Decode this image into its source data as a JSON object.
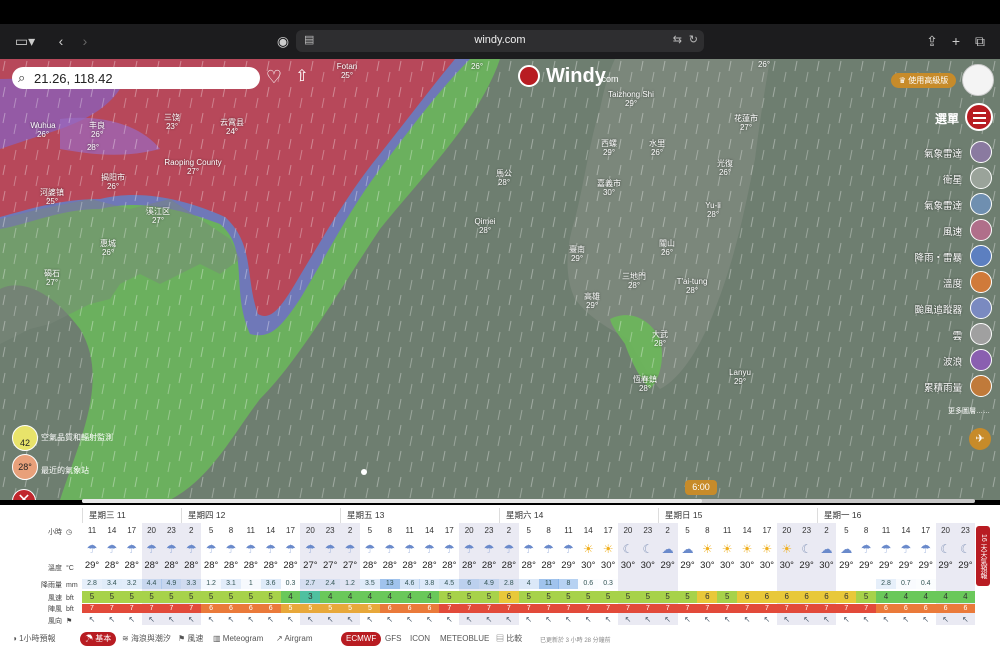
{
  "browser": {
    "url": "windy.com"
  },
  "map": {
    "search_value": "21.26, 118.42",
    "logo_name": "Windy",
    "logo_domain": ".com",
    "premium_label": "使用高級版",
    "menu_label": "選單",
    "labels": [
      {
        "name": "Fotan",
        "temp": "25°"
      },
      {
        "name": "",
        "temp": "26°"
      },
      {
        "name": "Wuhua",
        "temp": "26°"
      },
      {
        "name": "丰良",
        "temp": "26°"
      },
      {
        "name": "三饶",
        "temp": "23°"
      },
      {
        "name": "云霄县",
        "temp": "24°"
      },
      {
        "name": "Raoping County",
        "temp": "27°"
      },
      {
        "name": "揭阳市",
        "temp": "26°"
      },
      {
        "name": "河婆镇",
        "temp": "25°"
      },
      {
        "name": "",
        "temp": "28°"
      },
      {
        "name": "溪江区",
        "temp": "27°"
      },
      {
        "name": "惠城",
        "temp": "26°"
      },
      {
        "name": "碣石",
        "temp": "27°"
      },
      {
        "name": "Qimei",
        "temp": "28°"
      },
      {
        "name": "馬公",
        "temp": "28°"
      },
      {
        "name": "Taizhong Shi",
        "temp": "29°"
      },
      {
        "name": "花蓮市",
        "temp": "27°"
      },
      {
        "name": "",
        "temp": "26°"
      },
      {
        "name": "西螺",
        "temp": "29°"
      },
      {
        "name": "水里",
        "temp": "26°"
      },
      {
        "name": "嘉義市",
        "temp": "30°"
      },
      {
        "name": "光復",
        "temp": "26°"
      },
      {
        "name": "Yu-li",
        "temp": "28°"
      },
      {
        "name": "臺南",
        "temp": "29°"
      },
      {
        "name": "關山",
        "temp": "26°"
      },
      {
        "name": "三地門",
        "temp": "28°"
      },
      {
        "name": "T'ai-tung",
        "temp": "28°"
      },
      {
        "name": "高雄",
        "temp": "29°"
      },
      {
        "name": "大武",
        "temp": "28°"
      },
      {
        "name": "恆春鎮",
        "temp": "28°"
      },
      {
        "name": "Lanyu",
        "temp": "29°"
      }
    ],
    "layers": [
      {
        "label": "氣象雷達",
        "color": "#8a7aa0"
      },
      {
        "label": "衛星",
        "color": "#9aa39a"
      },
      {
        "label": "氣象雷達",
        "color": "#6f8fb0"
      },
      {
        "label": "風速",
        "color": "#b06f8a"
      },
      {
        "label": "降雨・雷暴",
        "color": "#5c7fc0"
      },
      {
        "label": "溫度",
        "color": "#d07a3a"
      },
      {
        "label": "颱風追蹤器",
        "color": "#7a8ac0"
      },
      {
        "label": "雲",
        "color": "#a0a0a0"
      },
      {
        "label": "波浪",
        "color": "#8a5fb0"
      },
      {
        "label": "累積雨量",
        "color": "#c07a3a"
      }
    ],
    "more_layers": "更多圖層……",
    "aqi_value": "42",
    "aqi_label": "空氣品質和輻射監測",
    "station_temp": "28°",
    "station_label": "最近的氣象站",
    "time_bubble": "6:00"
  },
  "forecast": {
    "days": [
      "星期三 11",
      "星期四 12",
      "星期五 13",
      "星期六 14",
      "星期日 15",
      "星期一 16"
    ],
    "row_labels": {
      "hours": "小時",
      "temp": "溫度",
      "temp_unit": "°C",
      "rain": "降雨量",
      "rain_unit": "mm",
      "wind": "風速",
      "wind_unit": "bft",
      "gust": "陣風",
      "gust_unit": "bft",
      "dir": "風向"
    },
    "hours": [
      "11",
      "14",
      "17",
      "20",
      "23",
      "2",
      "5",
      "8",
      "11",
      "14",
      "17",
      "20",
      "23",
      "2",
      "5",
      "8",
      "11",
      "14",
      "17",
      "20",
      "23",
      "2",
      "5",
      "8",
      "11",
      "14",
      "17",
      "20",
      "23",
      "2",
      "5",
      "8",
      "11",
      "14",
      "17",
      "20",
      "23",
      "2",
      "5",
      "8",
      "11",
      "14",
      "17",
      "20",
      "23"
    ],
    "temps": [
      "29°",
      "28°",
      "28°",
      "28°",
      "28°",
      "28°",
      "28°",
      "28°",
      "28°",
      "28°",
      "28°",
      "27°",
      "27°",
      "27°",
      "28°",
      "28°",
      "28°",
      "28°",
      "28°",
      "28°",
      "28°",
      "28°",
      "28°",
      "28°",
      "29°",
      "30°",
      "30°",
      "30°",
      "30°",
      "29°",
      "29°",
      "30°",
      "30°",
      "30°",
      "30°",
      "30°",
      "29°",
      "30°",
      "29°",
      "29°",
      "29°",
      "29°",
      "29°",
      "29°",
      "29°"
    ],
    "rain": [
      "2.8",
      "3.4",
      "3.2",
      "4.4",
      "4.9",
      "3.3",
      "1.2",
      "3.1",
      "1",
      "3.6",
      "0.3",
      "2.7",
      "2.4",
      "1.2",
      "3.5",
      "13",
      "4.6",
      "3.8",
      "4.5",
      "6",
      "4.9",
      "2.8",
      "4",
      "11",
      "8",
      "0.6",
      "0.3",
      "",
      "",
      "",
      "",
      "",
      "",
      "",
      "",
      "",
      "",
      "",
      "",
      "",
      "2.8",
      "0.7",
      "0.4",
      "",
      ""
    ],
    "wind": [
      "5",
      "5",
      "5",
      "5",
      "5",
      "5",
      "5",
      "5",
      "5",
      "5",
      "4",
      "3",
      "4",
      "4",
      "4",
      "4",
      "4",
      "4",
      "5",
      "5",
      "5",
      "6",
      "5",
      "5",
      "5",
      "5",
      "5",
      "5",
      "5",
      "5",
      "5",
      "6",
      "5",
      "6",
      "6",
      "6",
      "6",
      "6",
      "6",
      "5",
      "4",
      "4",
      "4",
      "4",
      "4"
    ],
    "gust": [
      "7",
      "7",
      "7",
      "7",
      "7",
      "7",
      "6",
      "6",
      "6",
      "6",
      "5",
      "5",
      "5",
      "5",
      "5",
      "6",
      "6",
      "6",
      "7",
      "7",
      "7",
      "7",
      "7",
      "7",
      "7",
      "7",
      "7",
      "7",
      "7",
      "7",
      "7",
      "7",
      "7",
      "7",
      "7",
      "7",
      "7",
      "7",
      "7",
      "7",
      "6",
      "6",
      "6",
      "6",
      "6"
    ],
    "compare_label": "16 天天氣預報"
  },
  "bottom_tabs": {
    "hourly": "1小時預報",
    "basic": "基本",
    "waves": "海浪與潮汐",
    "wind": "風速",
    "meteogram": "Meteogram",
    "airgram": "Airgram",
    "ecmwf": "ECMWF",
    "gfs": "GFS",
    "icon": "ICON",
    "meteoblue": "METEOBLUE",
    "compare": "比較",
    "updated": "已更新於 3 小時 28 分鐘前"
  }
}
